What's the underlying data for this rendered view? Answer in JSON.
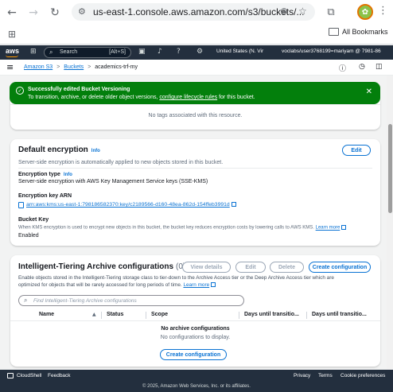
{
  "browser": {
    "url": "us-east-1.console.aws.amazon.com/s3/buckets/...",
    "bookmarks_label": "All Bookmarks"
  },
  "aws_nav": {
    "logo": "aws",
    "search_placeholder": "Search",
    "search_shortcut": "[Alt+S]",
    "region": "United States (N. Vir",
    "account": "voclabs/user3768199=mariyam @ 7981-86"
  },
  "breadcrumb": {
    "items": [
      "Amazon S3",
      "Buckets",
      "academics-trf-my"
    ],
    "separator": ">"
  },
  "flash": {
    "title": "Successfully edited Bucket Versioning",
    "message_pre": "To transition, archive, or delete older object versions, ",
    "message_link": "configure lifecycle rules",
    "message_post": " for this bucket.",
    "color": "#037f0c"
  },
  "tags": {
    "empty_text": "No tags associated with this resource."
  },
  "encryption": {
    "title": "Default encryption",
    "info": "Info",
    "edit_label": "Edit",
    "description": "Server-side encryption is automatically applied to new objects stored in this bucket.",
    "type_label": "Encryption type",
    "type_info": "Info",
    "type_value": "Server-side encryption with AWS Key Management Service keys (SSE-KMS)",
    "arn_label": "Encryption key ARN",
    "arn_value": "arn:aws:kms:us-east-1:798186582370:key/c2189566-d160-48ea-862d-154ffeb3991d",
    "bucket_key_label": "Bucket Key",
    "bucket_key_desc": "When KMS encryption is used to encrypt new objects in this bucket, the bucket key reduces encryption costs by lowering calls to AWS KMS.",
    "learn_more": "Learn more",
    "bucket_key_value": "Enabled"
  },
  "intelligent_tiering": {
    "title": "Intelligent-Tiering Archive configurations",
    "count": "(0)",
    "buttons": {
      "view": "View details",
      "edit": "Edit",
      "delete": "Delete",
      "create": "Create configuration"
    },
    "description_1": "Enable objects stored in the Intelligent-Tiering storage class to tier-down to the Archive Access tier or the Deep Archive Access tier which are",
    "description_2": "optimized for objects that will be rarely accessed for long periods of time.",
    "learn_more": "Learn more",
    "filter_placeholder": "Find Intelligent-Tiering Archive configurations",
    "columns": [
      "Name",
      "Status",
      "Scope",
      "Days until transitio...",
      "Days until transitio..."
    ],
    "empty_title": "No archive configurations",
    "empty_sub": "No configurations to display.",
    "empty_button": "Create configuration"
  },
  "footer": {
    "cloudshell": "CloudShell",
    "feedback": "Feedback",
    "privacy": "Privacy",
    "terms": "Terms",
    "cookie": "Cookie preferences",
    "copyright": "© 2025, Amazon Web Services, Inc. or its affiliates."
  },
  "colors": {
    "aws_nav_bg": "#232f3e",
    "link": "#0972d3",
    "success": "#037f0c",
    "accent_orange": "#ff9900"
  }
}
